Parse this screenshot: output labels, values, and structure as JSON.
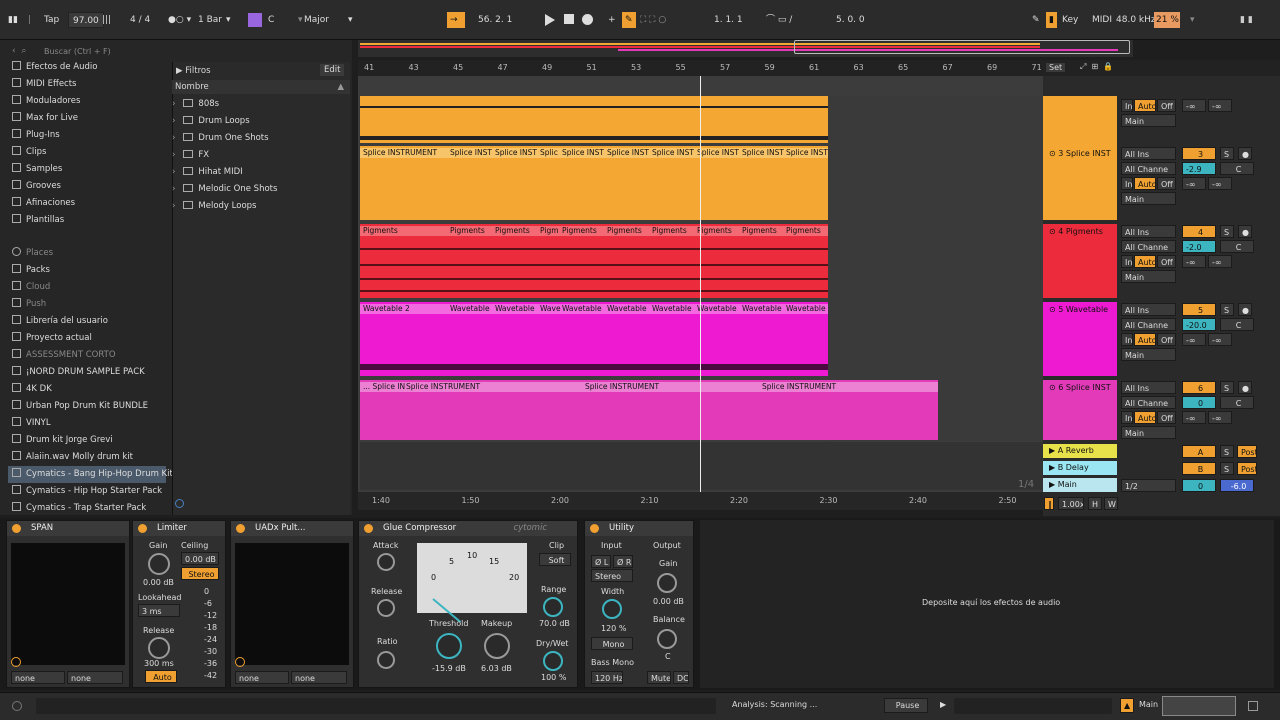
{
  "transport": {
    "tap": "Tap",
    "tempo": "97.00",
    "signature": "4 / 4",
    "quantize": "1 Bar",
    "key_root": "C",
    "scale": "Major",
    "position": "56.  2.  1",
    "loop_start": "1.  1.  1",
    "loop_length": "5.  0.  0",
    "key_label": "Key",
    "midi_label": "MIDI",
    "sample_rate": "48.0 kHz",
    "cpu": "21 %"
  },
  "browser": {
    "search_placeholder": "Buscar (Ctrl + F)",
    "categories": [
      "Efectos de Audio",
      "MIDI Effects",
      "Moduladores",
      "Max for Live",
      "Plug-Ins",
      "Clips",
      "Samples",
      "Grooves",
      "Afinaciones",
      "Plantillas"
    ],
    "places_header": "Places",
    "places": [
      "Packs",
      "Cloud",
      "Push",
      "Librería del usuario",
      "Proyecto actual",
      "ASSESSMENT CORTO",
      "¡NORD DRUM SAMPLE PACK",
      "4K DK",
      "Urban Pop Drum Kit BUNDLE",
      "VINYL",
      "Drum kit Jorge Grevi",
      "Alaiin.wav Molly drum kit",
      "Cymatics - Bang Hip-Hop Drum Kit",
      "Cymatics - Hip Hop Starter Pack",
      "Cymatics - Trap Starter Pack"
    ],
    "filters_label": "Filtros",
    "edit_label": "Edit",
    "name_header": "Nombre",
    "files": [
      "808s",
      "Drum Loops",
      "Drum One Shots",
      "FX",
      "Hihat MIDI",
      "Melodic One Shots",
      "Melody Loops"
    ]
  },
  "ruler": [
    "41",
    "43",
    "45",
    "47",
    "49",
    "51",
    "53",
    "55",
    "57",
    "59",
    "61",
    "63",
    "65",
    "67",
    "69",
    "71"
  ],
  "set_label": "Set",
  "timeline": [
    "1:40",
    "1:50",
    "2:00",
    "2:10",
    "2:20",
    "2:30",
    "2:40",
    "2:50"
  ],
  "time_fraction": "1/4",
  "tracks": [
    {
      "name": "",
      "color": "#f5a733",
      "clip_labels": []
    },
    {
      "name": "3 Splice INST",
      "number": "3",
      "volume": "-2.9",
      "color": "#f5a733",
      "clip_labels": [
        "Splice INSTRUMENT",
        "Splice INST",
        "Splice INST",
        "Splic",
        "Splice INST",
        "Splice INST",
        "Splice INST",
        "Splice INST",
        "Splice INST",
        "Splice INST"
      ]
    },
    {
      "name": "4 Pigments",
      "number": "4",
      "volume": "-2.0",
      "color": "#ec2c3c",
      "clip_labels": [
        "Pigments",
        "Pigments",
        "Pigments",
        "Pigm",
        "Pigments",
        "Pigments",
        "Pigments",
        "Pigments",
        "Pigments",
        "Pigments"
      ]
    },
    {
      "name": "5 Wavetable",
      "number": "5",
      "volume": "-20.0",
      "color": "#ee1ad2",
      "clip_labels": [
        "Wavetable 2",
        "Wavetable",
        "Wavetable",
        "Wave",
        "Wavetable",
        "Wavetable",
        "Wavetable",
        "Wavetable",
        "Wavetable",
        "Wavetable"
      ]
    },
    {
      "name": "6 Splice INST",
      "number": "6",
      "volume": "0",
      "color": "#e23ab8",
      "clip_labels": [
        "... Splice IN",
        "Splice INSTRUMENT",
        "Splice INSTRUMENT",
        "Splice INSTRUMENT"
      ]
    }
  ],
  "returns": [
    {
      "name": "A Reverb",
      "letter": "A",
      "color": "#e8e24a"
    },
    {
      "name": "B Delay",
      "letter": "B",
      "color": "#9ae6f2"
    },
    {
      "name": "Main",
      "color": "#b9e6ef"
    }
  ],
  "mixer_labels": {
    "all_ins": "All Ins",
    "all_channels": "All Channe",
    "in": "In",
    "auto": "Auto",
    "off": "Off",
    "neg_inf": "-∞",
    "main": "Main",
    "solo": "S",
    "pan": "C",
    "post": "Post",
    "main_out": "1/2",
    "main_vol": "0",
    "main_meter": "-6.0",
    "speed": "1.00x",
    "h": "H",
    "w": "W"
  },
  "devices": {
    "span": {
      "title": "SPAN",
      "left_sel": "none",
      "right_sel": "none"
    },
    "limiter": {
      "title": "Limiter",
      "gain_label": "Gain",
      "gain_value": "0.00 dB",
      "ceiling_label": "Ceiling",
      "ceiling_value": "0.00 dB",
      "stereo": "Stereo",
      "lookahead_label": "Lookahead",
      "lookahead_value": "3 ms",
      "release_label": "Release",
      "release_value": "300 ms",
      "auto": "Auto",
      "scale": [
        "0",
        "-6",
        "-12",
        "-18",
        "-24",
        "-30",
        "-36",
        "-42"
      ]
    },
    "uadx": {
      "title": "UADx Pult...",
      "left_sel": "none",
      "right_sel": "none"
    },
    "glue": {
      "title": "Glue Compressor",
      "brand": "cytomic",
      "attack": "Attack",
      "release": "Release",
      "ratio": "Ratio",
      "threshold_label": "Threshold",
      "threshold_value": "-15.9 dB",
      "makeup_label": "Makeup",
      "makeup_value": "6.03 dB",
      "clip": "Clip",
      "soft": "Soft",
      "range_label": "Range",
      "range_value": "70.0 dB",
      "drywet_label": "Dry/Wet",
      "drywet_value": "100 %",
      "meter_ticks": [
        "0",
        "5",
        "10",
        "15",
        "20"
      ]
    },
    "utility": {
      "title": "Utility",
      "input": "Input",
      "output": "Output",
      "phase_l": "Ø L",
      "phase_r": "Ø R",
      "stereo": "Stereo",
      "width_label": "Width",
      "width_value": "120 %",
      "mono": "Mono",
      "bass_mono": "Bass Mono",
      "bass_freq": "120 Hz",
      "gain_label": "Gain",
      "gain_value": "0.00 dB",
      "balance_label": "Balance",
      "balance_value": "C",
      "mute": "Mute",
      "dc": "DC"
    },
    "drop_hint": "Deposite aquí los efectos de audio"
  },
  "status": {
    "analysis": "Analysis: Scanning ...",
    "pause": "Pause",
    "main": "Main"
  }
}
